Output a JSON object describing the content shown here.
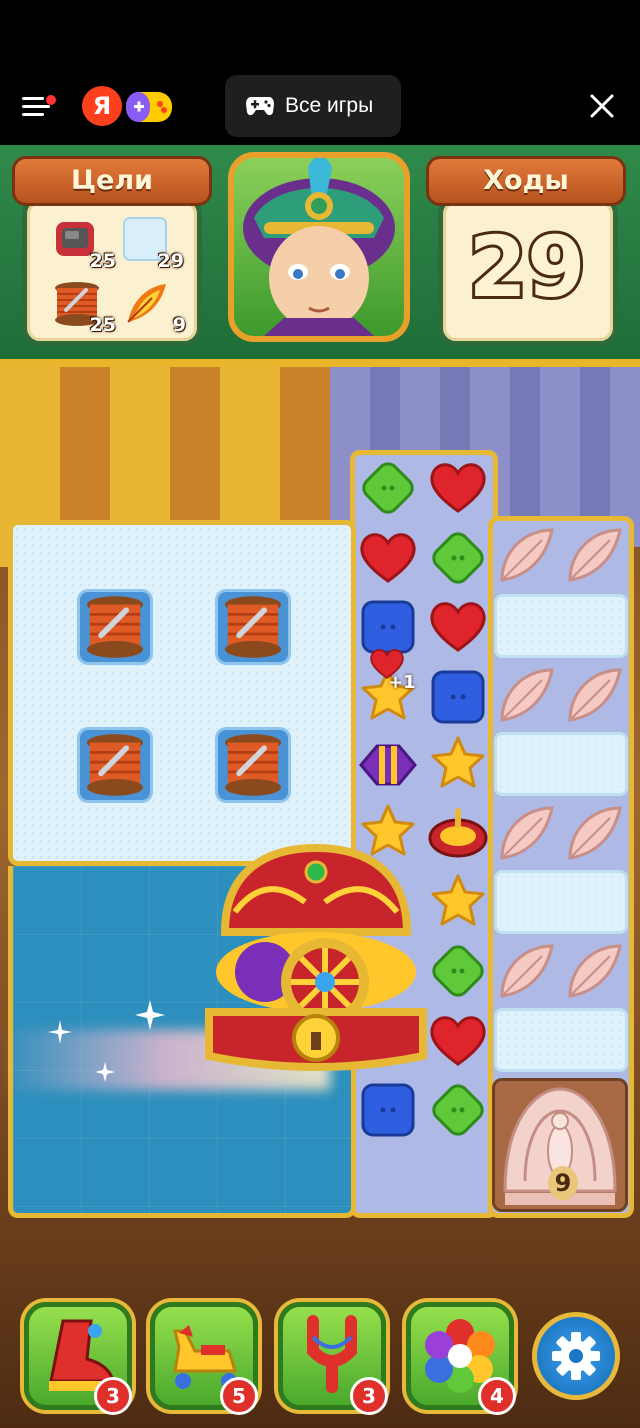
{
  "browser": {
    "all_games_label": "Все игры",
    "ya_letter": "Я"
  },
  "goals": {
    "title": "Цели",
    "items": [
      {
        "icon": "tv-icon",
        "count": "25"
      },
      {
        "icon": "ice-block-icon",
        "count": "29"
      },
      {
        "icon": "thread-spool-icon",
        "count": "25"
      },
      {
        "icon": "feather-flame-icon",
        "count": "9"
      }
    ]
  },
  "moves": {
    "title": "Ходы",
    "value": "29"
  },
  "board": {
    "bonus_text": "+1",
    "peacock_count": "9"
  },
  "boosters": [
    {
      "icon": "boot-booster-icon",
      "count": "3"
    },
    {
      "icon": "rocking-horse-booster-icon",
      "count": "5"
    },
    {
      "icon": "slingshot-booster-icon",
      "count": "3"
    },
    {
      "icon": "rainbow-flower-booster-icon",
      "count": "4"
    }
  ],
  "colors": {
    "hud_green": "#2f8a4a",
    "frame_gold": "#e6b834",
    "plank_orange": "#e07a3a"
  }
}
